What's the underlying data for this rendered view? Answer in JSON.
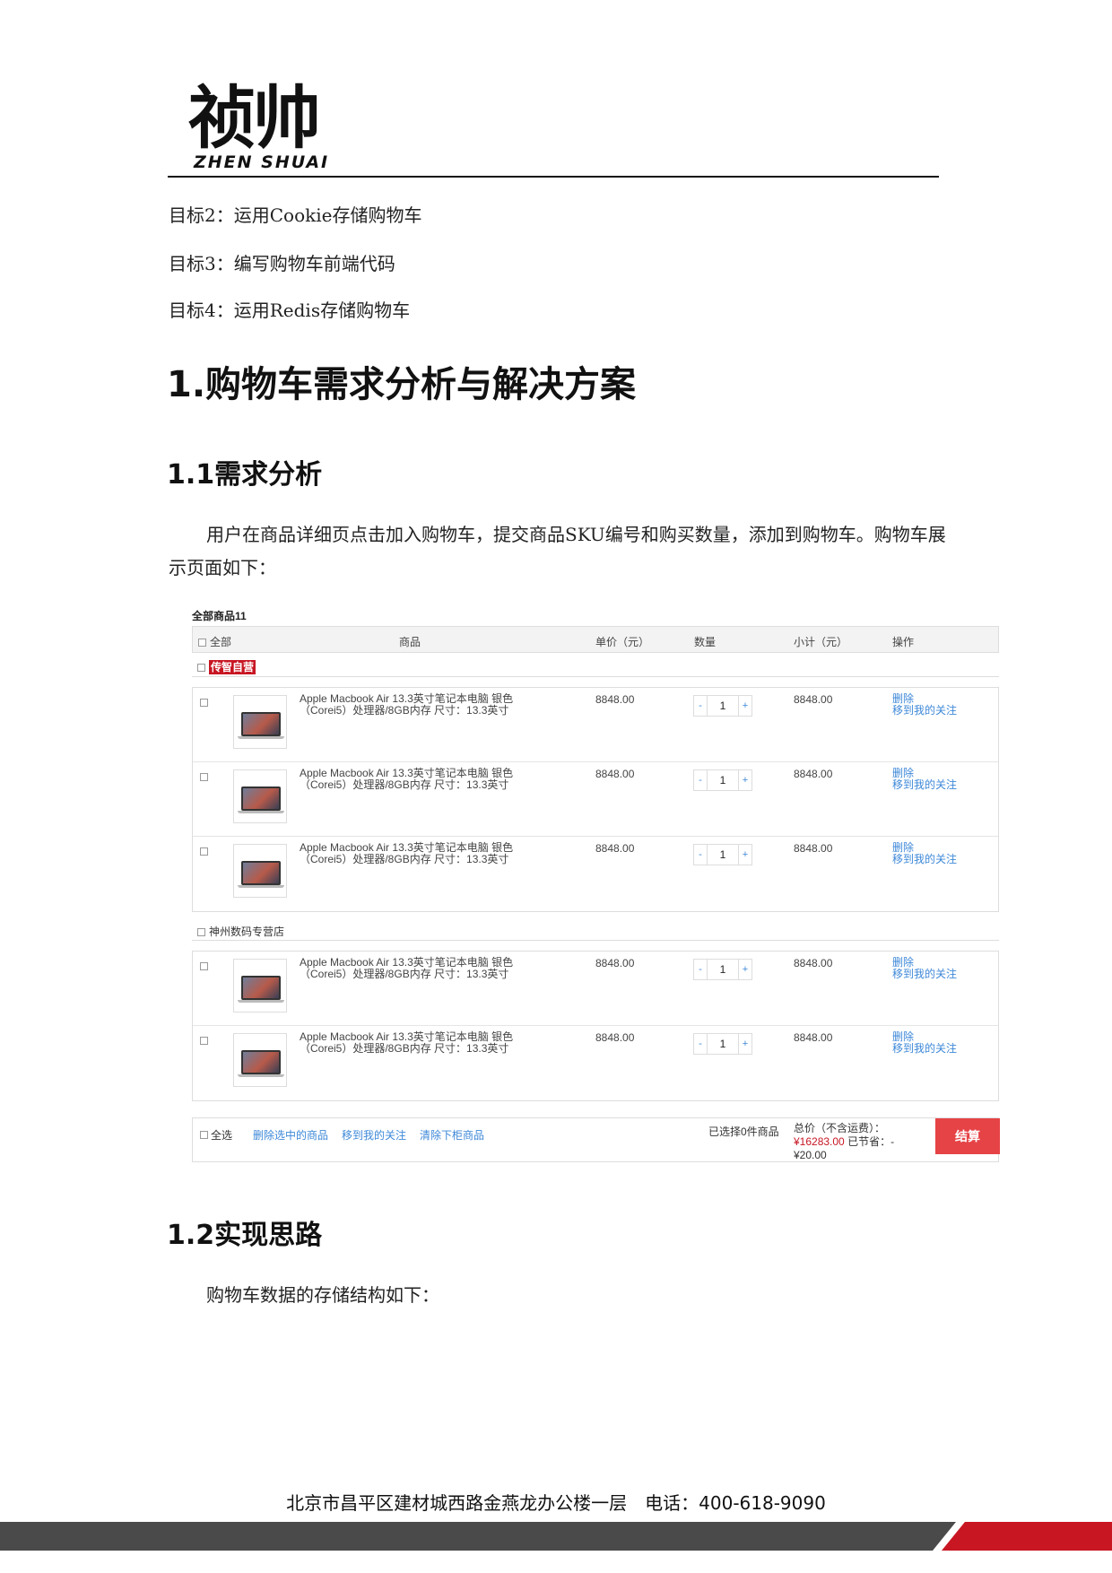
{
  "header": {
    "logo_cn": "祯帅",
    "logo_en": "ZHEN SHUAI"
  },
  "goals": [
    "目标2：运用Cookie存储购物车",
    "目标3：编写购物车前端代码",
    "目标4：运用Redis存储购物车"
  ],
  "section1": {
    "title": "1.购物车需求分析与解决方案"
  },
  "section1_1": {
    "title": "1.1需求分析",
    "paragraph": "用户在商品详细页点击加入购物车，提交商品SKU编号和购买数量，添加到购物车。购物车展示页面如下："
  },
  "cart": {
    "title": "全部商品11",
    "columns": {
      "all": "全部",
      "product": "商品",
      "unit_price": "单价（元）",
      "quantity": "数量",
      "subtotal": "小计（元）",
      "operation": "操作"
    },
    "shops": [
      {
        "name": "传智自营"
      },
      {
        "name": "神州数码专营店"
      }
    ],
    "item": {
      "desc_line1": "Apple Macbook Air 13.3英寸笔记本电脑 银色",
      "desc_line2": "（Corei5）处理器/8GB内存 尺寸：13.3英寸",
      "price": "8848.00",
      "qty_minus": "-",
      "qty": "1",
      "qty_plus": "+",
      "subtotal": "8848.00",
      "op_delete": "删除",
      "op_follow": "移到我的关注"
    },
    "footer": {
      "select_all": "全选",
      "delete_selected": "删除选中的商品",
      "move_follow": "移到我的关注",
      "clear_removed": "清除下柜商品",
      "selected_count": "已选择0件商品",
      "total_label": "总价（不含运费）：",
      "total_value": "¥16283.00",
      "saved_label": "已节省：-",
      "saved_value": "¥20.00",
      "checkout": "结算"
    }
  },
  "section1_2": {
    "title": "1.2实现思路",
    "paragraph": "购物车数据的存储结构如下："
  },
  "footer": {
    "address": "北京市昌平区建材城西路金燕龙办公楼一层　电话：400-618-9090"
  },
  "colors": {
    "brand_red": "#c81623",
    "link_blue": "#3d88d8",
    "band_gray": "#4a4a4a"
  }
}
